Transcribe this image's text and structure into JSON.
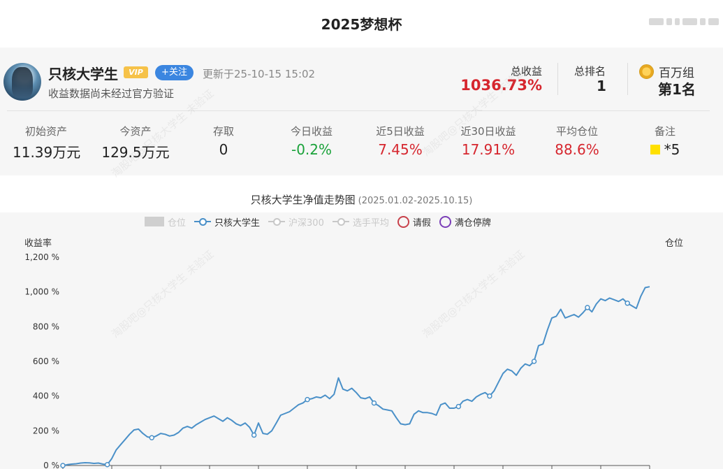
{
  "page": {
    "title": "2025梦想杯"
  },
  "profile": {
    "name": "只核大学生",
    "vip": "VIP",
    "follow_label": "+关注",
    "updated": "更新于25-10-15 15:02",
    "verify_note": "收益数据尚未经过官方验证"
  },
  "summary": {
    "total_return_label": "总收益",
    "total_return_value": "1036.73%",
    "rank_label": "总排名",
    "rank_value": "1",
    "group_label": "百万组",
    "group_rank": "第1名"
  },
  "stats": [
    {
      "label": "初始资产",
      "value": "11.39万元",
      "color": "dark"
    },
    {
      "label": "今资产",
      "value": "129.5万元",
      "color": "dark"
    },
    {
      "label": "存取",
      "value": "0",
      "color": "dark"
    },
    {
      "label": "今日收益",
      "value": "-0.2%",
      "color": "green"
    },
    {
      "label": "近5日收益",
      "value": "7.45%",
      "color": "red"
    },
    {
      "label": "近30日收益",
      "value": "17.91%",
      "color": "red"
    },
    {
      "label": "平均仓位",
      "value": "88.6%",
      "color": "red"
    },
    {
      "label": "备注",
      "value": "*5",
      "color": "dark"
    }
  ],
  "watermark": "淘股吧@只核大学生 未验证",
  "chart": {
    "title": "只核大学生净值走势图",
    "range": "(2025.01.02-2025.10.15)",
    "legend": [
      {
        "name": "仓位",
        "kind": "box",
        "active": false
      },
      {
        "name": "只核大学生",
        "kind": "line",
        "active": true,
        "color": "#4a90c8"
      },
      {
        "name": "沪深300",
        "kind": "line",
        "active": false
      },
      {
        "name": "选手平均",
        "kind": "line",
        "active": false
      },
      {
        "name": "请假",
        "kind": "ring",
        "active": true,
        "color": "#c8414b"
      },
      {
        "name": "满仓停牌",
        "kind": "ring",
        "active": true,
        "color": "#7b3fb8"
      }
    ],
    "y_axis_left_name": "收益率",
    "y_axis_right_name": "仓位",
    "y_tick_labels": [
      "0 %",
      "200 %",
      "400 %",
      "600 %",
      "800 %",
      "1,000 %",
      "1,200 %"
    ]
  },
  "chart_data": {
    "type": "line",
    "title": "只核大学生净值走势图",
    "ylabel": "收益率",
    "y2label": "仓位",
    "ylim": [
      0,
      1200
    ],
    "series": [
      {
        "name": "只核大学生",
        "color": "#4a90c8",
        "values": [
          0,
          5,
          8,
          10,
          14,
          16,
          15,
          12,
          14,
          8,
          5,
          40,
          90,
          120,
          150,
          180,
          205,
          210,
          185,
          165,
          160,
          170,
          185,
          180,
          170,
          175,
          190,
          215,
          225,
          215,
          235,
          250,
          265,
          275,
          285,
          270,
          255,
          275,
          260,
          240,
          230,
          245,
          220,
          175,
          245,
          185,
          180,
          200,
          245,
          290,
          300,
          310,
          330,
          350,
          360,
          380,
          385,
          395,
          390,
          405,
          385,
          410,
          505,
          440,
          430,
          445,
          420,
          390,
          385,
          395,
          360,
          345,
          325,
          320,
          315,
          275,
          240,
          235,
          240,
          295,
          315,
          305,
          305,
          300,
          290,
          350,
          360,
          330,
          330,
          340,
          370,
          380,
          370,
          395,
          410,
          420,
          400,
          430,
          480,
          530,
          555,
          545,
          520,
          560,
          585,
          575,
          600,
          690,
          700,
          780,
          850,
          860,
          900,
          850,
          860,
          870,
          855,
          880,
          910,
          885,
          930,
          960,
          950,
          965,
          955,
          945,
          960,
          935,
          920,
          905,
          975,
          1025,
          1030
        ]
      }
    ],
    "markers": [
      0,
      10,
      20,
      43,
      55,
      70,
      89,
      96,
      106,
      118,
      127
    ]
  }
}
